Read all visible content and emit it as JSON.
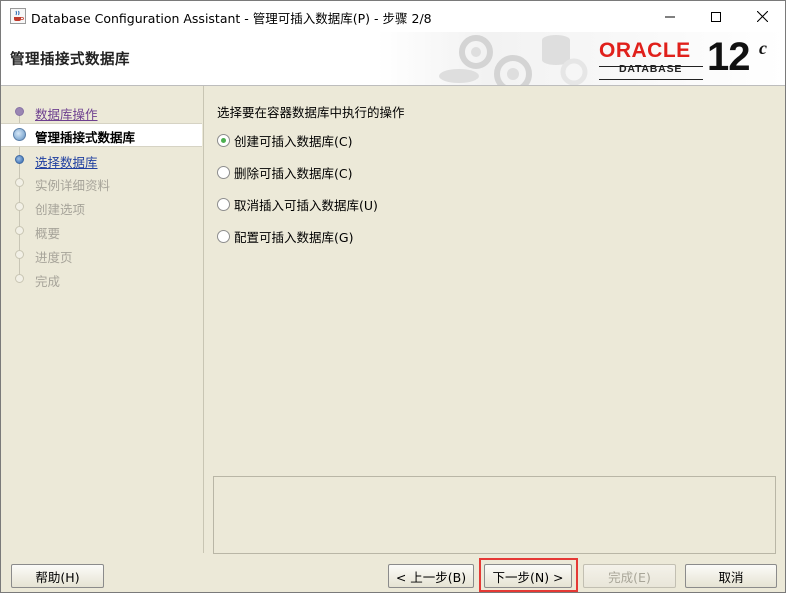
{
  "window": {
    "title": "Database Configuration Assistant - 管理可插入数据库(P) - 步骤 2/8",
    "icon": "java-cup-icon"
  },
  "header": {
    "page_title": "管理插接式数据库",
    "logo": {
      "brand": "ORACLE",
      "product": "DATABASE",
      "version": "12",
      "version_suffix": "c",
      "brand_color": "#e0201b"
    }
  },
  "nav": {
    "items": [
      {
        "label": "数据库操作",
        "state": "done"
      },
      {
        "label": "管理插接式数据库",
        "state": "current"
      },
      {
        "label": "选择数据库",
        "state": "link"
      },
      {
        "label": "实例详细资料",
        "state": "disabled"
      },
      {
        "label": "创建选项",
        "state": "disabled"
      },
      {
        "label": "概要",
        "state": "disabled"
      },
      {
        "label": "进度页",
        "state": "disabled"
      },
      {
        "label": "完成",
        "state": "disabled"
      }
    ]
  },
  "main": {
    "prompt": "选择要在容器数据库中执行的操作",
    "options": [
      {
        "label": "创建可插入数据库(C)",
        "checked": true
      },
      {
        "label": "删除可插入数据库(C)",
        "checked": false
      },
      {
        "label": "取消插入可插入数据库(U)",
        "checked": false
      },
      {
        "label": "配置可插入数据库(G)",
        "checked": false
      }
    ]
  },
  "buttons": {
    "help": "帮助(H)",
    "back": "< 上一步(B)",
    "next": "下一步(N) >",
    "finish": "完成(E)",
    "cancel": "取消"
  },
  "colors": {
    "highlight": "#e53935",
    "radio_dot": "#4caf50"
  }
}
